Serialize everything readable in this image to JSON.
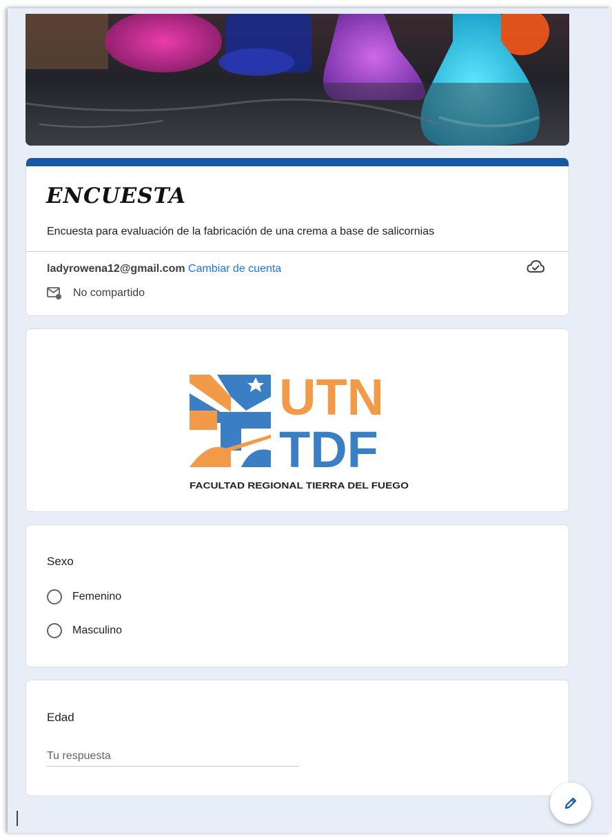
{
  "form": {
    "title": "ENCUESTA",
    "description": "Encuesta para evaluación de la fabricación de una crema a base de salicornias",
    "accent_color": "#1a56a6"
  },
  "account": {
    "email": "ladyrowena12@gmail.com",
    "switch_label": "Cambiar de cuenta",
    "not_shared_label": "No compartido"
  },
  "logo": {
    "line1": "UTN",
    "line2": "TDF",
    "caption": "FACULTAD REGIONAL TIERRA DEL FUEGO",
    "blue": "#3a7fc4",
    "orange": "#f29a47"
  },
  "questions": {
    "sexo": {
      "title": "Sexo",
      "options": [
        "Femenino",
        "Masculino"
      ]
    },
    "edad": {
      "title": "Edad",
      "placeholder": "Tu respuesta"
    }
  },
  "icons": {
    "cloud": "cloud-check-icon",
    "mail": "mail-lock-icon",
    "fab": "pencil-icon"
  }
}
